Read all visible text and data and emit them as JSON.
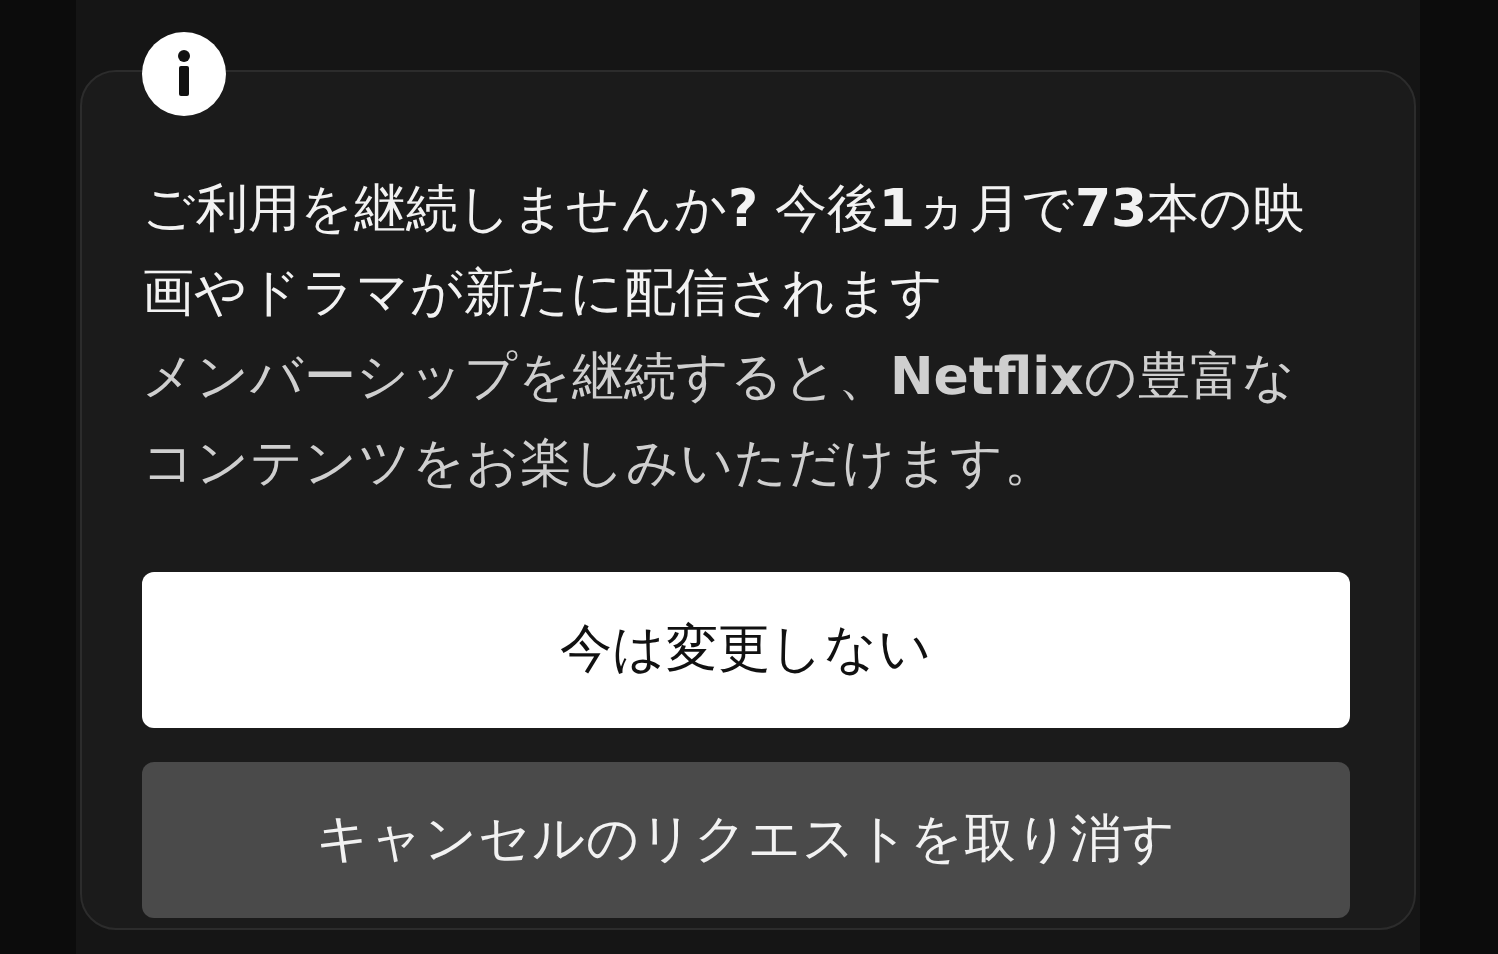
{
  "dialog": {
    "title": "ご利用を継続しませんか**?** 今後**1**ヵ月で**73**本の映画やドラマが新たに配信されます",
    "message": "メンバーシップを継続すると、**Netflix**の豊富なコンテンツをお楽しみいただけます。",
    "buttons": [
      {
        "label": "今は変更しない",
        "kind": "primary"
      },
      {
        "label": "キャンセルのリクエストを取り消す",
        "kind": "secondary"
      }
    ]
  }
}
